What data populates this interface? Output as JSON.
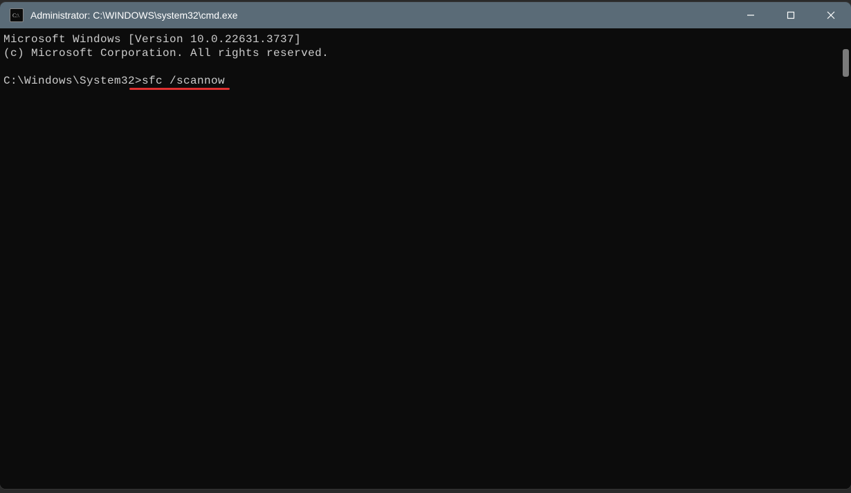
{
  "window": {
    "title": "Administrator: C:\\WINDOWS\\system32\\cmd.exe"
  },
  "terminal": {
    "line1": "Microsoft Windows [Version 10.0.22631.3737]",
    "line2": "(c) Microsoft Corporation. All rights reserved.",
    "blank": "",
    "prompt": "C:\\Windows\\System32>",
    "command": "sfc /scannow"
  },
  "annotation": {
    "underline_color": "#e03030"
  }
}
